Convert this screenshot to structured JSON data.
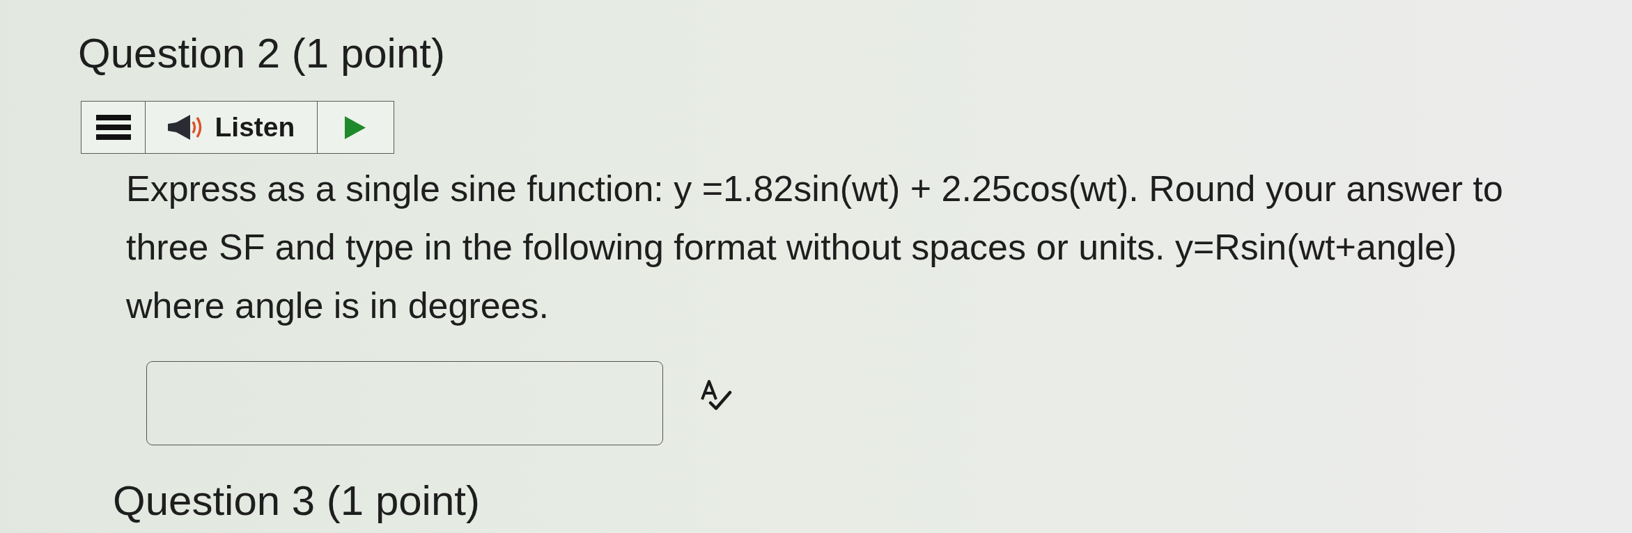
{
  "question": {
    "title": "Question 2 (1 point)"
  },
  "toolbar": {
    "listen_label": "Listen"
  },
  "prompt": "Express as a single sine function: y =1.82sin(wt) + 2.25cos(wt). Round your answer to three SF and type in the following format without spaces or units. y=Rsin(wt+angle) where angle is in degrees.",
  "next_question": {
    "title": "Question 3 (1 point)"
  }
}
